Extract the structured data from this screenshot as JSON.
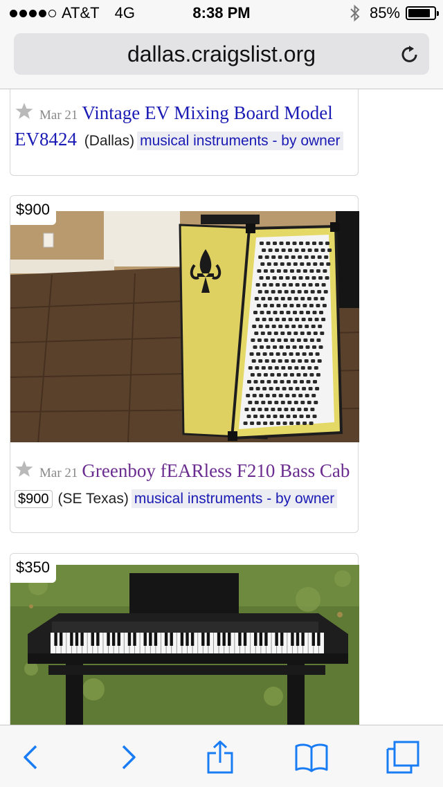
{
  "status_bar": {
    "carrier": "AT&T",
    "network": "4G",
    "time": "8:38 PM",
    "battery": "85%",
    "battery_level": 0.85
  },
  "browser": {
    "url": "dallas.craigslist.org"
  },
  "listings": [
    {
      "date": "Mar 21",
      "title": "Vintage EV Mixing Board Model EV8424",
      "location": "(Dallas)",
      "category": "musical instruments - by owner"
    },
    {
      "price_tag": "$900",
      "date": "Mar 21",
      "title": "Greenboy fEARless F210 Bass Cab",
      "price": "$900",
      "location": "(SE Texas)",
      "category": "musical instruments - by owner"
    },
    {
      "price_tag": "$350"
    }
  ],
  "icons": {
    "back": "chevron-left-icon",
    "forward": "chevron-right-icon",
    "share": "share-icon",
    "bookmarks": "book-icon",
    "tabs": "tabs-icon",
    "favorite": "star-icon",
    "reload": "reload-icon"
  },
  "colors": {
    "link": "#1a1ab4",
    "visited_link": "#6a2c8f",
    "ios_blue": "#1a7cf5"
  }
}
